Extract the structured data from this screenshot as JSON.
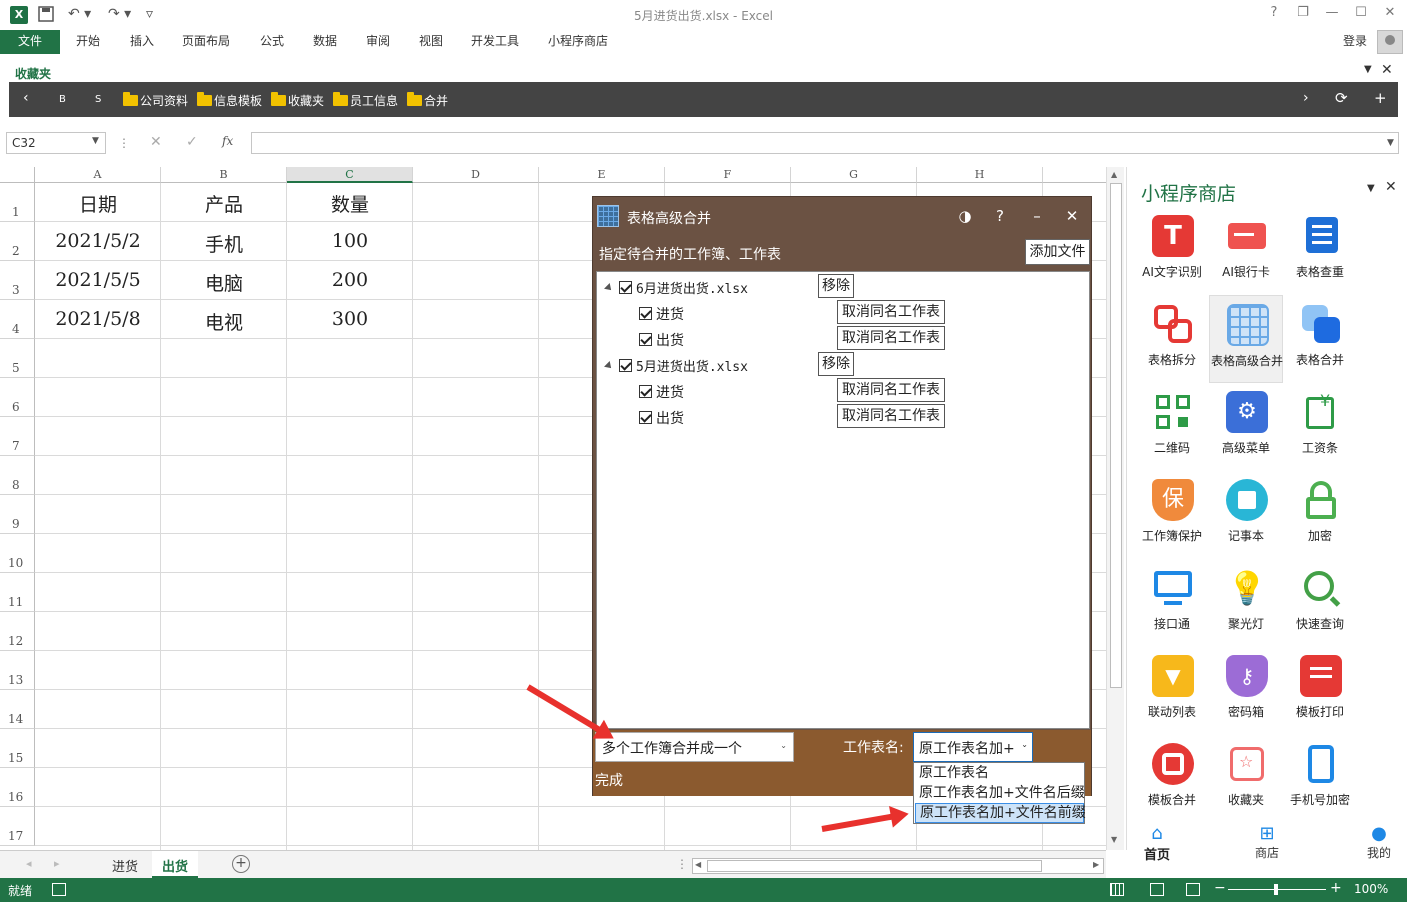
{
  "window": {
    "title": "5月进货出货.xlsx - Excel",
    "help": "?",
    "restore": "❐",
    "minimize": "—",
    "maximize": "☐",
    "close": "✕"
  },
  "ribbon": {
    "tabs": [
      "文件",
      "开始",
      "插入",
      "页面布局",
      "公式",
      "数据",
      "审阅",
      "视图",
      "开发工具",
      "小程序商店"
    ],
    "login": "登录"
  },
  "favorites": {
    "label": "收藏夹",
    "nav_b": "B",
    "nav_s": "S",
    "folders": [
      "公司资料",
      "信息模板",
      "收藏夹",
      "员工信息",
      "合并"
    ]
  },
  "formula": {
    "namebox": "C32",
    "cancel": "✕",
    "confirm": "✓",
    "fx": "fx"
  },
  "grid": {
    "columns": [
      "A",
      "B",
      "C",
      "D",
      "E",
      "F",
      "G",
      "H"
    ],
    "selected_column": "C",
    "rows": [
      "1",
      "2",
      "3",
      "4",
      "5",
      "6",
      "7",
      "8",
      "9",
      "10",
      "11",
      "12",
      "13",
      "14",
      "15",
      "16",
      "17"
    ],
    "cells": [
      [
        "日期",
        "产品",
        "数量"
      ],
      [
        "2021/5/2",
        "手机",
        "100"
      ],
      [
        "2021/5/5",
        "电脑",
        "200"
      ],
      [
        "2021/5/8",
        "电视",
        "300"
      ]
    ]
  },
  "sheets": {
    "tabs": [
      "进货",
      "出货"
    ],
    "active": "出货",
    "add": "+"
  },
  "status": {
    "ready": "就绪",
    "zoom": "100%"
  },
  "panel": {
    "title": "小程序商店",
    "apps": [
      {
        "label": "AI文字识别",
        "color": "#e53935"
      },
      {
        "label": "AI银行卡",
        "color": "#ef5350"
      },
      {
        "label": "表格查重",
        "color": "#1e6fd6"
      },
      {
        "label": "表格拆分",
        "color": "#e53935"
      },
      {
        "label": "表格高级合并",
        "color": "#6aa9e6"
      },
      {
        "label": "表格合并",
        "color": "#1e88e5"
      },
      {
        "label": "二维码",
        "color": "#2e9b47"
      },
      {
        "label": "高级菜单",
        "color": "#3b6fd8"
      },
      {
        "label": "工资条",
        "color": "#2e9b47"
      },
      {
        "label": "工作簿保护",
        "color": "#f08a3c"
      },
      {
        "label": "记事本",
        "color": "#29b6d6"
      },
      {
        "label": "加密",
        "color": "#4caf50"
      },
      {
        "label": "接口通",
        "color": "#1e88e5"
      },
      {
        "label": "聚光灯",
        "color": "#29b6f6"
      },
      {
        "label": "快速查询",
        "color": "#43a047"
      },
      {
        "label": "联动列表",
        "color": "#f7b81b"
      },
      {
        "label": "密码箱",
        "color": "#9c6cd6"
      },
      {
        "label": "模板打印",
        "color": "#e53935"
      },
      {
        "label": "模板合并",
        "color": "#e53935"
      },
      {
        "label": "收藏夹",
        "color": "#f06c6c"
      },
      {
        "label": "手机号加密",
        "color": "#1e88e5"
      }
    ],
    "nav": [
      "首页",
      "商店",
      "我的"
    ]
  },
  "dialog": {
    "title": "表格高级合并",
    "subtitle": "指定待合并的工作簿、工作表",
    "add_file": "添加文件",
    "workbooks": [
      {
        "name": "6月进货出货.xlsx",
        "remove": "移除",
        "sheets": [
          {
            "name": "进货",
            "action": "取消同名工作表"
          },
          {
            "name": "出货",
            "action": "取消同名工作表"
          }
        ]
      },
      {
        "name": "5月进货出货.xlsx",
        "remove": "移除",
        "sheets": [
          {
            "name": "进货",
            "action": "取消同名工作表"
          },
          {
            "name": "出货",
            "action": "取消同名工作表"
          }
        ]
      }
    ],
    "mode": "多个工作簿合并成一个",
    "sheet_name_label": "工作表名:",
    "sheet_name_value": "原工作表名加+",
    "options": [
      "原工作表名",
      "原工作表名加+文件名后缀",
      "原工作表名加+文件名前缀"
    ],
    "finish": "完成"
  }
}
